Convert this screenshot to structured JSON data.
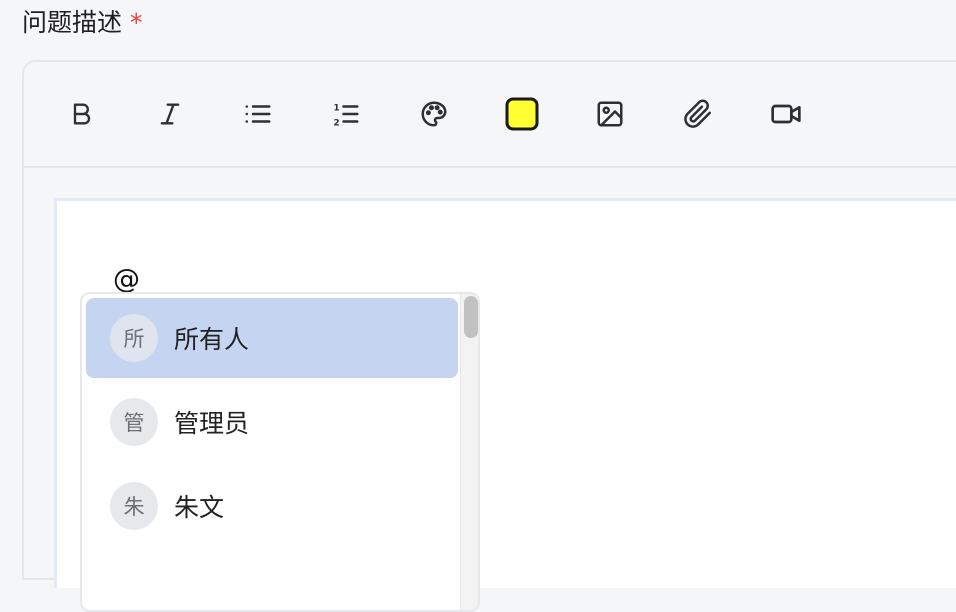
{
  "field": {
    "label": "问题描述",
    "required_mark": "*"
  },
  "toolbar": {
    "tools": [
      {
        "name": "bold",
        "icon": "bold-icon"
      },
      {
        "name": "italic",
        "icon": "italic-icon"
      },
      {
        "name": "bullet-list",
        "icon": "bullet-list-icon"
      },
      {
        "name": "ordered-list",
        "icon": "ordered-list-icon"
      },
      {
        "name": "text-color",
        "icon": "palette-icon"
      },
      {
        "name": "highlight-color",
        "icon": "highlight-color-icon",
        "color": "#ffff33"
      },
      {
        "name": "insert-image",
        "icon": "image-icon"
      },
      {
        "name": "attach-file",
        "icon": "paperclip-icon"
      },
      {
        "name": "insert-video",
        "icon": "video-icon"
      }
    ]
  },
  "editor": {
    "typed_text": "@"
  },
  "mention_popup": {
    "items": [
      {
        "avatar": "所",
        "name": "所有人",
        "active": true
      },
      {
        "avatar": "管",
        "name": "管理员",
        "active": false
      },
      {
        "avatar": "朱",
        "name": "朱文",
        "active": false
      }
    ]
  },
  "colors": {
    "active_item_bg": "#c5d5f1",
    "required": "#f04040",
    "highlight_swatch": "#ffff33"
  }
}
